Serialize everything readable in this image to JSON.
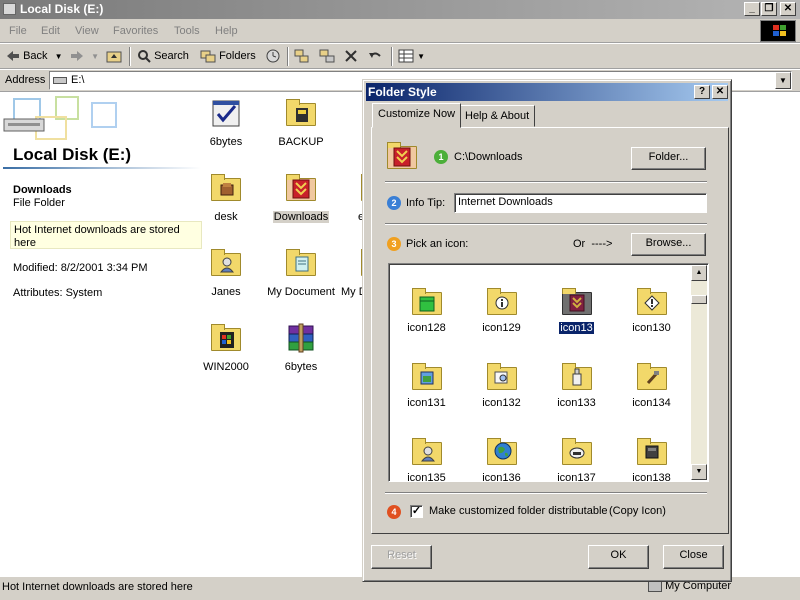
{
  "window": {
    "title": "Local Disk (E:)",
    "minimize_glyph": "_",
    "restore_glyph": "❐",
    "close_glyph": "✕"
  },
  "menu": [
    "File",
    "Edit",
    "View",
    "Favorites",
    "Tools",
    "Help"
  ],
  "toolbar": {
    "back_label": "Back",
    "search_label": "Search",
    "folders_label": "Folders"
  },
  "address": {
    "label": "Address",
    "value": "E:\\"
  },
  "left_pane": {
    "title": "Local Disk (E:)",
    "selected_name": "Downloads",
    "selected_type": "File Folder",
    "description": "Hot Internet downloads are stored here",
    "modified": "Modified: 8/2/2001 3:34 PM",
    "attributes": "Attributes: System"
  },
  "files": [
    {
      "label": "6bytes",
      "icon": "checkmark-doc-icon"
    },
    {
      "label": "BACKUP",
      "icon": "backup-folder-icon"
    },
    {
      "label": "desk",
      "icon": "desk-folder-icon"
    },
    {
      "label": "Downloads",
      "icon": "downloads-folder-icon",
      "selected": true
    },
    {
      "label": "e",
      "icon": "folder-icon"
    },
    {
      "label": "Janes",
      "icon": "janes-folder-icon"
    },
    {
      "label": "My Document",
      "icon": "my-document-folder-icon"
    },
    {
      "label": "My D",
      "icon": "folder-icon"
    },
    {
      "label": "WIN2000",
      "icon": "win2000-folder-icon"
    },
    {
      "label": "6bytes",
      "icon": "winrar-icon"
    }
  ],
  "status": {
    "text": "Hot Internet downloads are stored here",
    "zone": "My Computer"
  },
  "dialog": {
    "title": "Folder Style",
    "help_glyph": "?",
    "close_glyph": "✕",
    "tabs": [
      "Customize Now",
      "Help & About"
    ],
    "step1": {
      "badge": "1",
      "path": "C:\\Downloads",
      "button": "Folder..."
    },
    "step2": {
      "badge": "2",
      "label": "Info Tip:",
      "value": "Internet Downloads"
    },
    "step3": {
      "badge": "3",
      "label": "Pick an icon:",
      "or_text": "Or  ---->",
      "button": "Browse..."
    },
    "icons": [
      {
        "label": "icon128",
        "icon": "green-bar-folder-icon"
      },
      {
        "label": "icon129",
        "icon": "info-folder-icon"
      },
      {
        "label": "icon13",
        "icon": "downloads-arrow-folder-icon",
        "selected": true
      },
      {
        "label": "icon130",
        "icon": "warning-folder-icon"
      },
      {
        "label": "icon131",
        "icon": "window-folder-icon"
      },
      {
        "label": "icon132",
        "icon": "magnifier-folder-icon"
      },
      {
        "label": "icon133",
        "icon": "bottle-folder-icon"
      },
      {
        "label": "icon134",
        "icon": "tools-folder-icon"
      },
      {
        "label": "icon135",
        "icon": "person-folder-icon"
      },
      {
        "label": "icon136",
        "icon": "globe-folder-icon"
      },
      {
        "label": "icon137",
        "icon": "drive-folder-icon"
      },
      {
        "label": "icon138",
        "icon": "dark-box-folder-icon"
      }
    ],
    "step4": {
      "badge": "4",
      "checked": true,
      "label": "Make customized folder distributable",
      "copy_icon": "(Copy Icon)"
    },
    "buttons": {
      "reset": "Reset",
      "ok": "OK",
      "close": "Close"
    }
  },
  "colors": {
    "dialog_title_start": "#0a246a",
    "dialog_title_end": "#a6caf0",
    "face": "#d4d0c8",
    "badge_green": "#4caf3a",
    "badge_blue": "#3a7fd5",
    "badge_orange": "#f0a020",
    "badge_red": "#e05020",
    "downloads_red": "#c8202a"
  }
}
